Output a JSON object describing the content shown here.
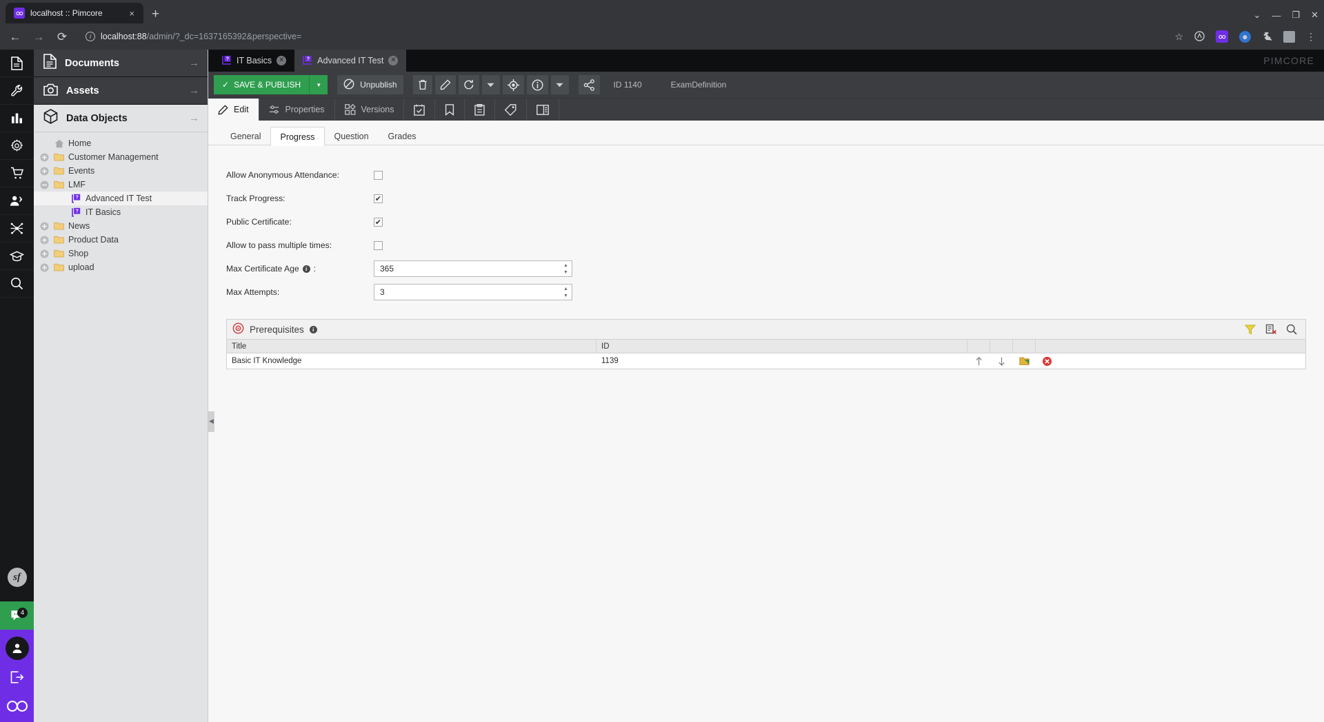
{
  "browser": {
    "tab_title": "localhost :: Pimcore",
    "tab_close": "×",
    "newtab": "+",
    "url_host": "localhost:88",
    "url_rest": "/admin/?_dc=1637165392&perspective=",
    "info_glyph": "i",
    "back": "←",
    "forward": "→",
    "reload": "⟳",
    "star": "☆",
    "menu": "⋮",
    "window_min": "—",
    "window_max": "❐",
    "window_close": "✕",
    "window_chevron": "⌄"
  },
  "rail": {
    "items": [
      {
        "name": "documents-icon",
        "label": "Documents"
      },
      {
        "name": "tools-icon",
        "label": "Tools"
      },
      {
        "name": "analytics-icon",
        "label": "Reports"
      },
      {
        "name": "settings-gear-icon",
        "label": "Settings"
      },
      {
        "name": "ecommerce-cart-icon",
        "label": "E-Commerce"
      },
      {
        "name": "customers-icon",
        "label": "Customers"
      },
      {
        "name": "marketing-network-icon",
        "label": "Marketing"
      },
      {
        "name": "graduation-cap-icon",
        "label": "LMS"
      },
      {
        "name": "search-icon",
        "label": "Search"
      }
    ],
    "symfony_label": "sf",
    "chat_badge": "4",
    "user_label": "Profile",
    "logout_label": "Logout",
    "pimcore_label": "Pimcore"
  },
  "tree_panel": {
    "sections": [
      {
        "label": "Documents",
        "icon": "document-icon",
        "active": false
      },
      {
        "label": "Assets",
        "icon": "camera-icon",
        "active": false
      },
      {
        "label": "Data Objects",
        "icon": "cube-icon",
        "active": true
      }
    ],
    "arrow": "→",
    "nodes": [
      {
        "label": "Home",
        "indent": 0,
        "expander": "",
        "icon": "home-icon",
        "selected": false
      },
      {
        "label": "Customer Management",
        "indent": 0,
        "expander": "+",
        "icon": "folder-icon",
        "selected": false
      },
      {
        "label": "Events",
        "indent": 0,
        "expander": "+",
        "icon": "folder-icon",
        "selected": false
      },
      {
        "label": "LMF",
        "indent": 0,
        "expander": "-",
        "icon": "folder-icon",
        "selected": false
      },
      {
        "label": "Advanced IT Test",
        "indent": 1,
        "expander": "",
        "icon": "object-icon",
        "selected": true
      },
      {
        "label": "IT Basics",
        "indent": 1,
        "expander": "",
        "icon": "object-icon",
        "selected": false
      },
      {
        "label": "News",
        "indent": 0,
        "expander": "+",
        "icon": "folder-icon",
        "selected": false
      },
      {
        "label": "Product Data",
        "indent": 0,
        "expander": "+",
        "icon": "folder-icon",
        "selected": false
      },
      {
        "label": "Shop",
        "indent": 0,
        "expander": "+",
        "icon": "folder-icon",
        "selected": false
      },
      {
        "label": "upload",
        "indent": 0,
        "expander": "+",
        "icon": "folder-icon",
        "selected": false
      }
    ]
  },
  "main": {
    "tabs": [
      {
        "label": "IT Basics",
        "active": false,
        "close": "✕"
      },
      {
        "label": "Advanced IT Test",
        "active": true,
        "close": "✕"
      }
    ],
    "wordmark": "PIMCORE",
    "toolbar": {
      "save_label": "SAVE & PUBLISH",
      "save_check": "✓",
      "save_caret": "▼",
      "unpublish_label": "Unpublish",
      "unpublish_icon": "⃠",
      "buttons": [
        {
          "name": "delete-button",
          "glyph": "trash"
        },
        {
          "name": "rename-button",
          "glyph": "pencil"
        },
        {
          "name": "reload-button",
          "glyph": "reload"
        },
        {
          "name": "reload-menu-button",
          "glyph": "caret"
        },
        {
          "name": "locate-in-tree-button",
          "glyph": "target"
        },
        {
          "name": "info-button",
          "glyph": "info"
        },
        {
          "name": "info-menu-button",
          "glyph": "caret"
        },
        {
          "name": "share-button",
          "glyph": "share"
        }
      ],
      "object_id": "ID 1140",
      "class_name": "ExamDefinition"
    },
    "edit_tabs": [
      {
        "label": "Edit",
        "icon": "pencil-icon",
        "active": true
      },
      {
        "label": "Properties",
        "icon": "sliders-icon",
        "active": false
      },
      {
        "label": "Versions",
        "icon": "grid-icon",
        "active": false
      }
    ],
    "edit_icon_tabs": [
      {
        "name": "schedule-icon"
      },
      {
        "name": "bookmark-icon"
      },
      {
        "name": "tasks-icon"
      },
      {
        "name": "tags-icon"
      },
      {
        "name": "layout-icon"
      }
    ],
    "sub_tabs": [
      {
        "label": "General",
        "active": false
      },
      {
        "label": "Progress",
        "active": true
      },
      {
        "label": "Question",
        "active": false
      },
      {
        "label": "Grades",
        "active": false
      }
    ],
    "form": {
      "rows": [
        {
          "type": "checkbox",
          "label": "Allow Anonymous Attendance:",
          "checked": false,
          "name": "allow-anonymous-attendance"
        },
        {
          "type": "checkbox",
          "label": "Track Progress:",
          "checked": true,
          "name": "track-progress"
        },
        {
          "type": "checkbox",
          "label": "Public Certificate:",
          "checked": true,
          "name": "public-certificate"
        },
        {
          "type": "checkbox",
          "label": "Allow to pass multiple times:",
          "checked": false,
          "name": "allow-pass-multiple-times"
        },
        {
          "type": "number",
          "label": "Max Certificate Age",
          "suffix": ":",
          "info": true,
          "value": "365",
          "name": "max-certificate-age"
        },
        {
          "type": "number",
          "label": "Max Attempts:",
          "info": false,
          "value": "3",
          "name": "max-attempts"
        }
      ],
      "check_glyph": "✔",
      "spin_up": "▲",
      "spin_down": "▼"
    },
    "grid": {
      "title": "Prerequisites",
      "info_glyph": "i",
      "head_buttons": [
        {
          "name": "filter-button",
          "glyph": "filter"
        },
        {
          "name": "empty-relations-button",
          "glyph": "clear"
        },
        {
          "name": "search-button",
          "glyph": "search"
        }
      ],
      "columns": [
        "Title",
        "ID",
        "",
        "",
        ""
      ],
      "rows": [
        {
          "title": "Basic IT Knowledge",
          "id": "1139"
        }
      ],
      "row_actions": {
        "up": "↑",
        "down": "↓",
        "open": "open-icon",
        "remove": "remove-icon"
      }
    },
    "collapse_handle": "◀"
  }
}
